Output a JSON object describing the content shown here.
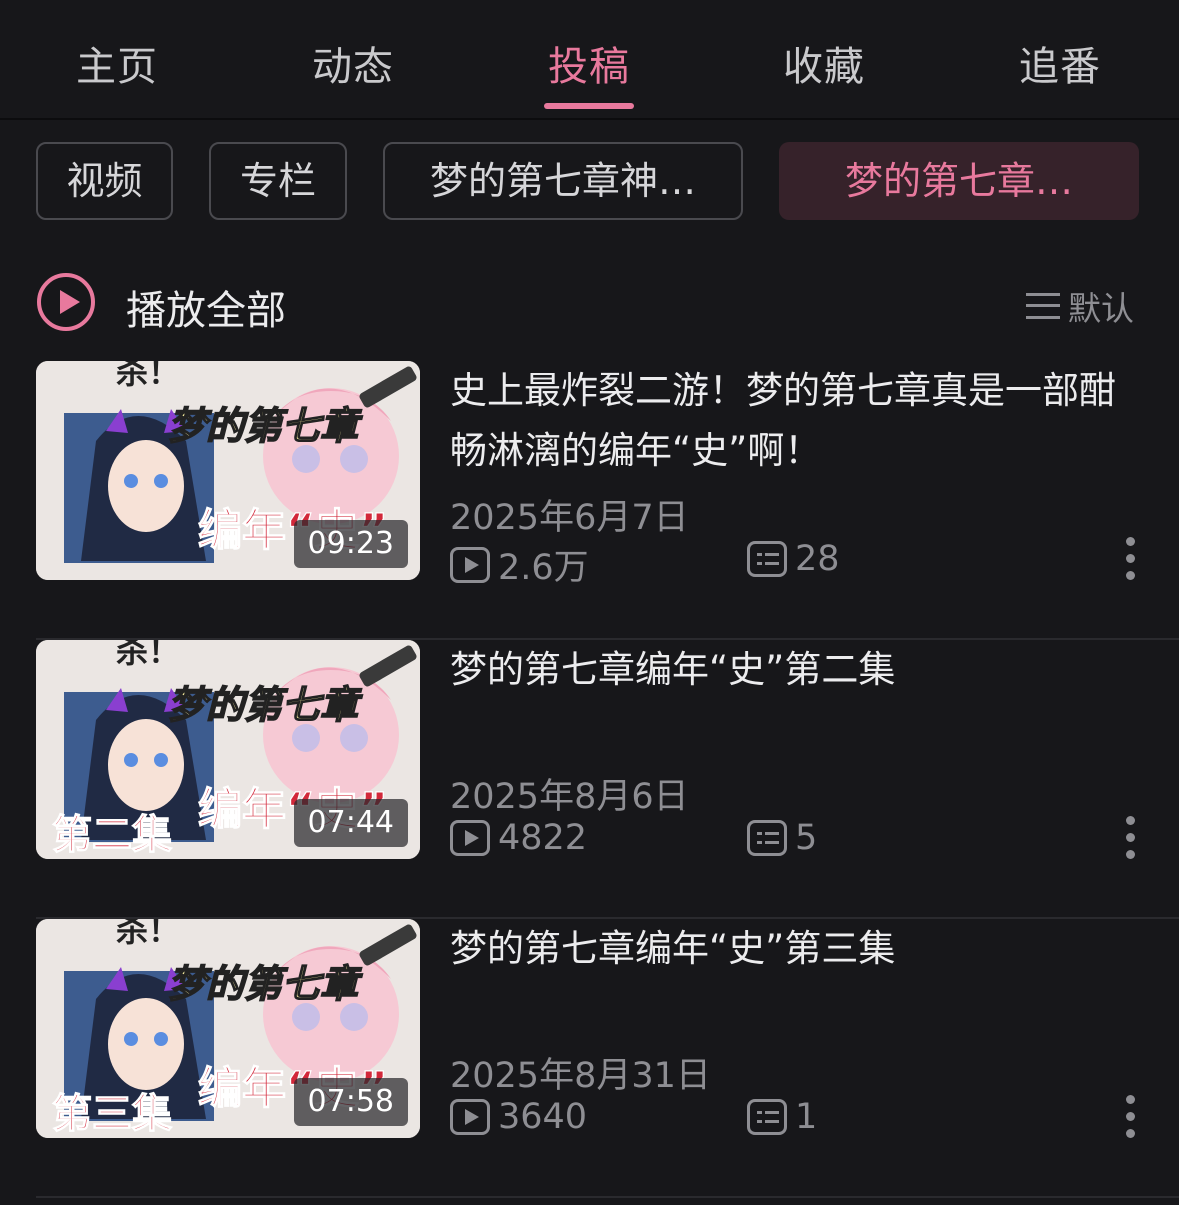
{
  "tabs": [
    {
      "label": "主页"
    },
    {
      "label": "动态"
    },
    {
      "label": "投稿"
    },
    {
      "label": "收藏"
    },
    {
      "label": "追番"
    }
  ],
  "active_tab": "投稿",
  "filters": [
    {
      "label": "视频"
    },
    {
      "label": "专栏"
    },
    {
      "label": "梦的第七章神…"
    },
    {
      "label": "梦的第七章…"
    }
  ],
  "play_all": {
    "label": "播放全部"
  },
  "sort": {
    "label": "默认"
  },
  "videos": [
    {
      "title": "史上最炸裂二游！梦的第七章真是一部酣畅淋漓的编年“史”啊！",
      "date": "2025年6月7日",
      "views": "2.6万",
      "comments": "28",
      "duration": "09:23",
      "thumb": {
        "top": "杀！",
        "main": "梦的第七章",
        "sub": "编年“史”",
        "episode": ""
      }
    },
    {
      "title": "梦的第七章编年“史”第二集",
      "date": "2025年8月6日",
      "views": "4822",
      "comments": "5",
      "duration": "07:44",
      "thumb": {
        "top": "杀！",
        "main": "梦的第七章",
        "sub": "编年“史”",
        "episode": "第二集"
      }
    },
    {
      "title": "梦的第七章编年“史”第三集",
      "date": "2025年8月31日",
      "views": "3640",
      "comments": "1",
      "duration": "07:58",
      "thumb": {
        "top": "杀！",
        "main": "梦的第七章",
        "sub": "编年“史”",
        "episode": "第三集"
      }
    }
  ],
  "colors": {
    "accent": "#e8799d",
    "background": "#17171a",
    "muted": "#8e8e93"
  }
}
